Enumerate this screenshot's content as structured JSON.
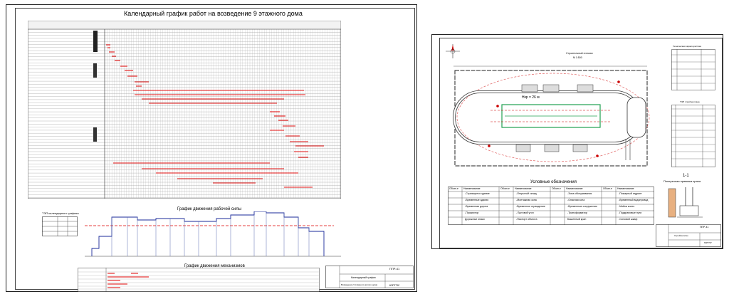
{
  "left_sheet": {
    "title": "Календарный график работ на возведение 9 этажного дома",
    "labor_chart_title": "График движения рабочей силы",
    "machines_chart_title": "График движения механизмов",
    "tep_title": "ТЭП календарного графика",
    "stamp": {
      "code": "ППР-41",
      "sheet_name": "Календарный график",
      "project_name": "Возведение 9 этажного жилого дома",
      "org": "ЮРГПУ"
    }
  },
  "right_sheet": {
    "plan_title": "Строительный генплан",
    "plan_scale": "М 1:500",
    "crane_label": "Hкр = 26 м",
    "tep_table_title": "Техническая характеристика",
    "tep2_title": "ТЭП стройгенплана",
    "legend_title": "Условные обозначения",
    "section_title": "1-1",
    "section_subtitle": "Поперечная привязка крана",
    "legend_headers": [
      "Обозн-е",
      "Наименование",
      "Обозн-е",
      "Наименование",
      "Обозн-е",
      "Наименование",
      "Обозн-е",
      "Наименование"
    ],
    "legend_col1": [
      "-Строящееся здание",
      "-Временные здания",
      "-Временная дорога",
      "-Прожектор",
      "Дорожные знаки"
    ],
    "legend_col2": [
      "-Открытый склад",
      "-Монтажная зона",
      "-Временное ограждение",
      "- Бытовой угол",
      "-Паспорт объекта"
    ],
    "legend_col3": [
      "-Зона обслуживания",
      "-Опасная зона",
      "-Временные сооружения",
      "-Трансформатор",
      "Башенный кран"
    ],
    "legend_col4": [
      "-Пожарный гидрант",
      "-Временный водопровод",
      "-Мойка колес",
      "-Подкрановые пути",
      "-Силовой шкаф"
    ],
    "stamp": {
      "code": "ППР-41",
      "sheet_name": "Стройгенплан",
      "org": "ЮРГПУ"
    }
  }
}
